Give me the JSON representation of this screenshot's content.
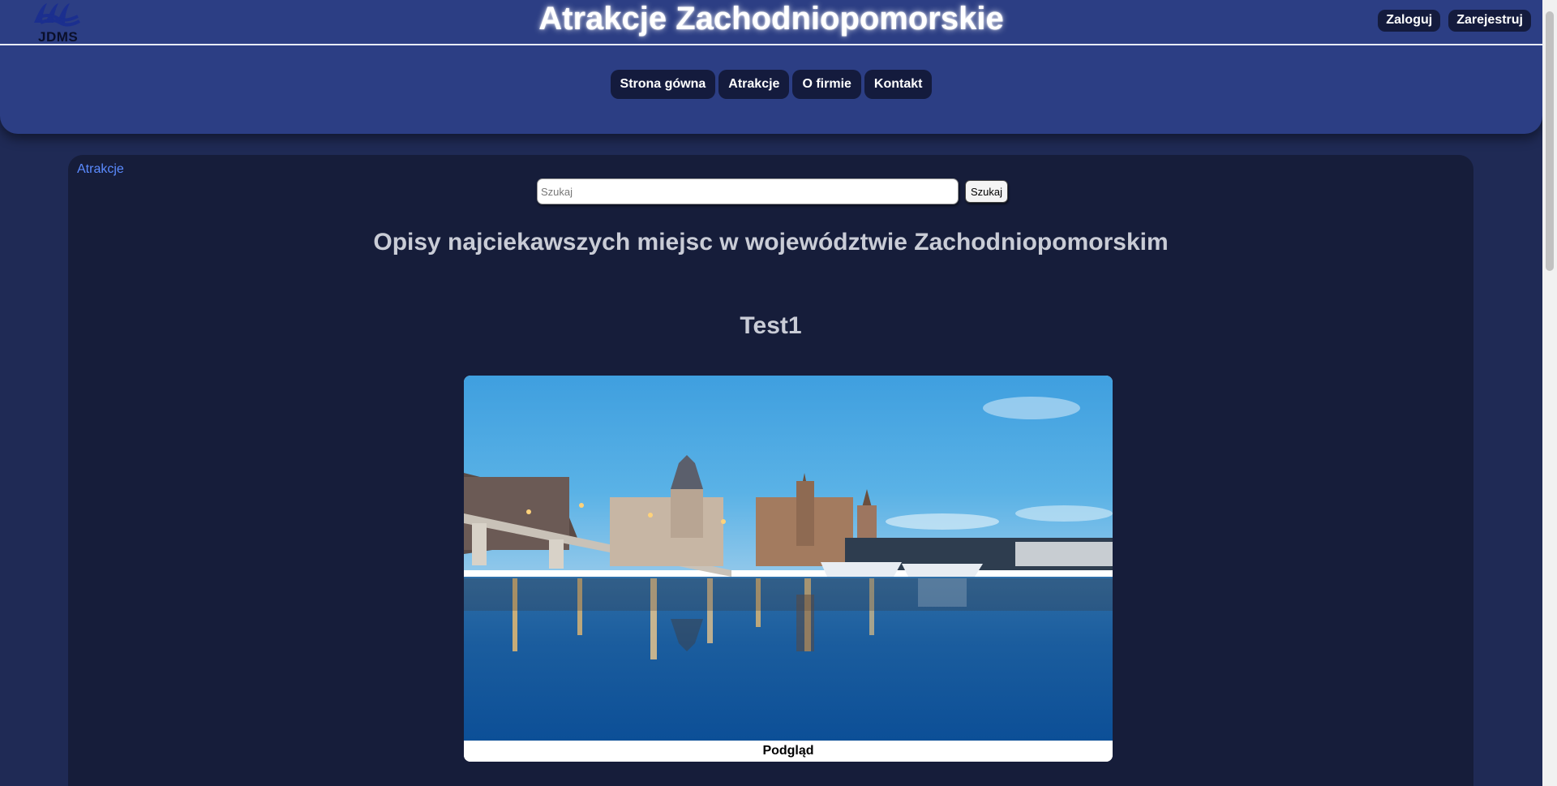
{
  "header": {
    "logo_text": "JDMS",
    "title": "Atrakcje Zachodniopomorskie",
    "auth": {
      "login_label": "Zaloguj",
      "register_label": "Zarejestruj"
    },
    "nav": [
      {
        "label": "Strona gówna"
      },
      {
        "label": "Atrakcje"
      },
      {
        "label": "O firmie"
      },
      {
        "label": "Kontakt"
      }
    ]
  },
  "main": {
    "breadcrumb": "Atrakcje",
    "search": {
      "placeholder": "Szukaj",
      "value": "",
      "button_label": "Szukaj"
    },
    "heading": "Opisy najciekawszych miejsc w województwie Zachodniopomorskim",
    "attraction": {
      "title": "Test1",
      "caption": "Podgląd"
    }
  },
  "colors": {
    "page_background": "#1f2a55",
    "header_background": "#2c3e84",
    "panel_background": "#161d3a",
    "button_background": "#141b3d",
    "link": "#5b8bff"
  }
}
